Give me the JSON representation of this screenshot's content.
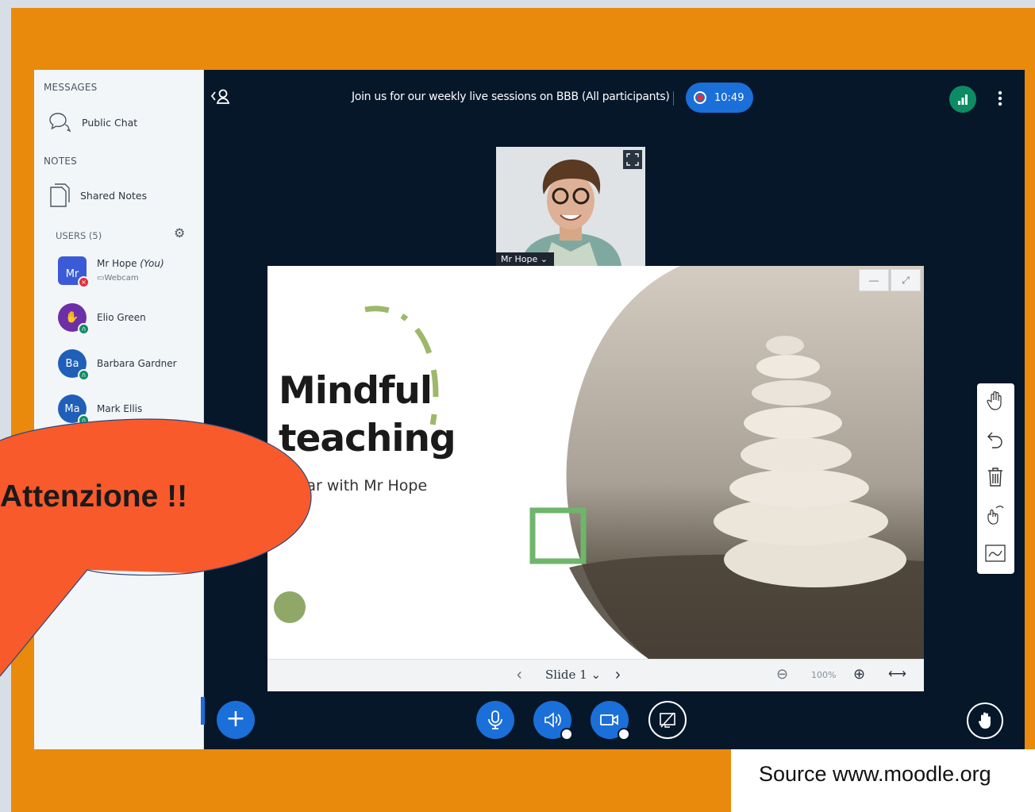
{
  "sidebar": {
    "messages_title": "MESSAGES",
    "public_chat": "Public Chat",
    "notes_title": "NOTES",
    "shared_notes": "Shared Notes",
    "users_title": "USERS (5)",
    "users": [
      {
        "initials": "Mr",
        "name": "Mr Hope",
        "you": "(You)",
        "sub": "Webcam",
        "color": "#3b5bd6"
      },
      {
        "initials": "",
        "name": "Elio Green",
        "color": "#6d2fa8"
      },
      {
        "initials": "Ba",
        "name": "Barbara Gardner",
        "color": "#1f5fb8"
      },
      {
        "initials": "Ma",
        "name": "Mark Ellis",
        "color": "#1f5fb8"
      }
    ]
  },
  "topbar": {
    "title": "Join us for our weekly live sessions on BBB (All participants)",
    "recording_time": "10:49"
  },
  "webcam": {
    "label": "Mr Hope"
  },
  "slide": {
    "title_line1": "Mindful",
    "title_line2": "teaching",
    "subtitle": "binar with Mr Hope"
  },
  "presentation_toolbar": {
    "slide_label": "Slide 1",
    "zoom": "100%"
  },
  "callout": {
    "text": "Attenzione !!"
  },
  "source": {
    "text": "Source www.moodle.org"
  },
  "colors": {
    "frame": "#e98a0c",
    "app_bg": "#06172a",
    "accent": "#1b6fd8",
    "callout": "#f95a2c",
    "recording": "#e0303c",
    "connection": "#0d8c63"
  }
}
